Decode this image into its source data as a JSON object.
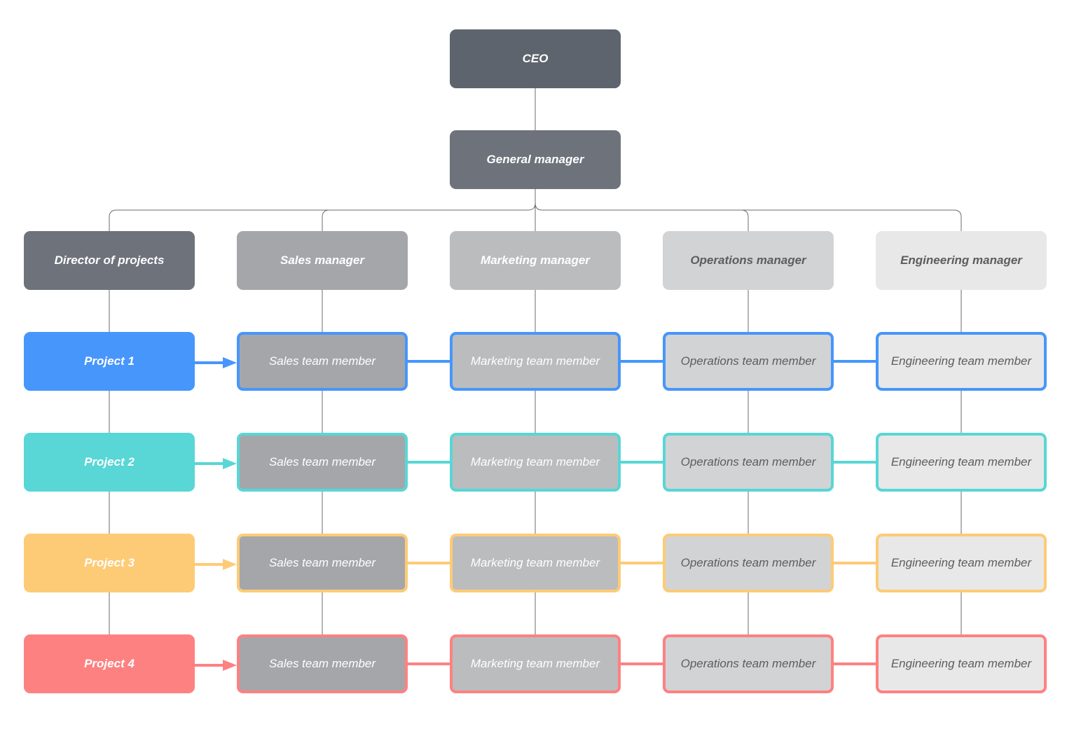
{
  "diagram": {
    "type": "org-chart-matrix",
    "top": [
      {
        "id": "ceo",
        "label": "CEO"
      },
      {
        "id": "gm",
        "label": "General manager"
      }
    ],
    "managers": [
      {
        "label": "Director of projects"
      },
      {
        "label": "Sales manager"
      },
      {
        "label": "Marketing manager"
      },
      {
        "label": "Operations manager"
      },
      {
        "label": "Engineering manager"
      }
    ],
    "projects": [
      {
        "label": "Project 1",
        "color": "#4696fc"
      },
      {
        "label": "Project 2",
        "color": "#59d6d6"
      },
      {
        "label": "Project 3",
        "color": "#fdcb76"
      },
      {
        "label": "Project 4",
        "color": "#fe8181"
      }
    ],
    "team_members": [
      "Sales team member",
      "Marketing team member",
      "Operations team member",
      "Engineering team member"
    ],
    "rows": [
      {
        "project": "Project 1",
        "members": [
          "Sales team member",
          "Marketing team member",
          "Operations team member",
          "Engineering team member"
        ]
      },
      {
        "project": "Project 2",
        "members": [
          "Sales team member",
          "Marketing team member",
          "Operations team member",
          "Engineering team member"
        ]
      },
      {
        "project": "Project 3",
        "members": [
          "Sales team member",
          "Marketing team member",
          "Operations team member",
          "Engineering team member"
        ]
      },
      {
        "project": "Project 4",
        "members": [
          "Sales team member",
          "Marketing team member",
          "Operations team member",
          "Engineering team member"
        ]
      }
    ],
    "edges": [
      {
        "from": "CEO",
        "to": "General manager"
      },
      {
        "from": "General manager",
        "to": "Director of projects"
      },
      {
        "from": "General manager",
        "to": "Sales manager"
      },
      {
        "from": "General manager",
        "to": "Marketing manager"
      },
      {
        "from": "General manager",
        "to": "Operations manager"
      },
      {
        "from": "General manager",
        "to": "Engineering manager"
      }
    ],
    "colors": {
      "connector": "#6b6b6b",
      "ceo": "#5e646d",
      "general_manager": "#6d727b"
    }
  }
}
